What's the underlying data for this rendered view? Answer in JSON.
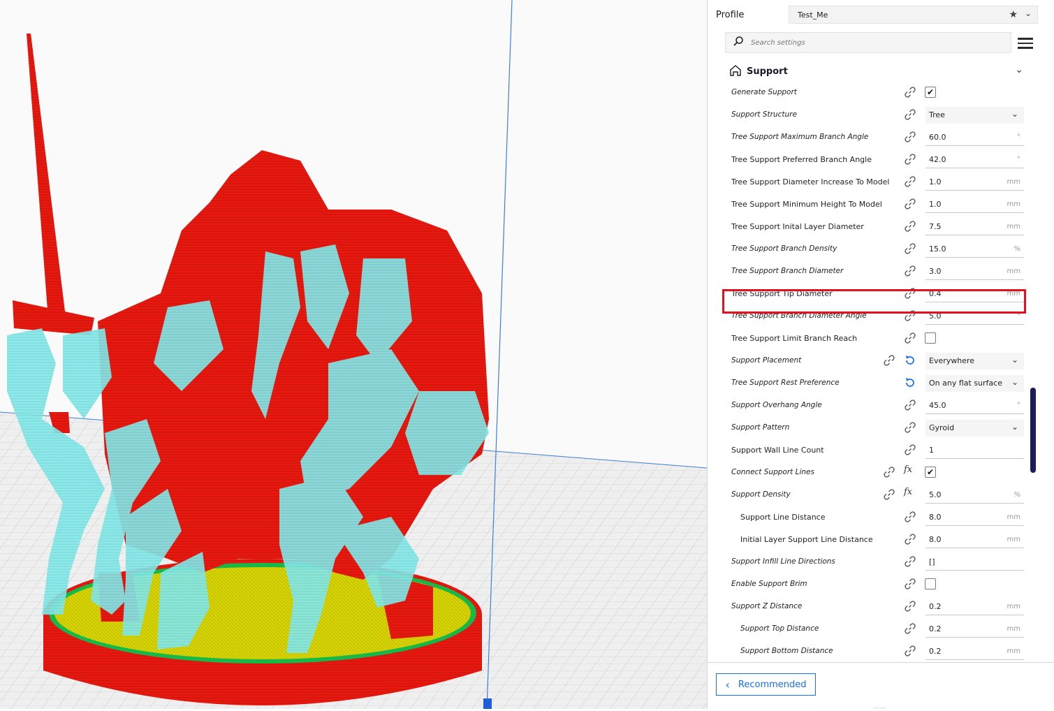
{
  "profile": {
    "label": "Profile",
    "value": "Test_Me"
  },
  "search": {
    "placeholder": "Search settings"
  },
  "category": {
    "label": "Support"
  },
  "settings": [
    {
      "label": "Generate Support",
      "type": "checkbox",
      "checked": true,
      "value": "✔"
    },
    {
      "label": "Support Structure",
      "type": "dropdown",
      "value": "Tree"
    },
    {
      "label": "Tree Support Maximum Branch Angle",
      "type": "number",
      "value": "60.0",
      "unit": "°"
    },
    {
      "label": "Tree Support Preferred Branch Angle",
      "type": "number",
      "value": "42.0",
      "unit": "°"
    },
    {
      "label": "Tree Support Diameter Increase To Model",
      "type": "number",
      "value": "1.0",
      "unit": "mm"
    },
    {
      "label": "Tree Support Minimum Height To Model",
      "type": "number",
      "value": "1.0",
      "unit": "mm"
    },
    {
      "label": "Tree Support Inital Layer Diameter",
      "type": "number",
      "value": "7.5",
      "unit": "mm"
    },
    {
      "label": "Tree Support Branch Density",
      "type": "number",
      "value": "15.0",
      "unit": "%"
    },
    {
      "label": "Tree Support Branch Diameter",
      "type": "number",
      "value": "3.0",
      "unit": "mm"
    },
    {
      "label": "Tree Support Tip Diameter",
      "type": "number",
      "value": "0.4",
      "unit": "mm"
    },
    {
      "label": "Tree Support Branch Diameter Angle",
      "type": "number",
      "value": "5.0",
      "unit": "°"
    },
    {
      "label": "Tree Support Limit Branch Reach",
      "type": "checkbox",
      "checked": false,
      "value": ""
    },
    {
      "label": "Support Placement",
      "type": "dropdown",
      "value": "Everywhere"
    },
    {
      "label": "Tree Support Rest Preference",
      "type": "dropdown",
      "value": "On any flat surface"
    },
    {
      "label": "Support Overhang Angle",
      "type": "number",
      "value": "45.0",
      "unit": "°"
    },
    {
      "label": "Support Pattern",
      "type": "dropdown",
      "value": "Gyroid"
    },
    {
      "label": "Support Wall Line Count",
      "type": "number",
      "value": "1",
      "unit": ""
    },
    {
      "label": "Connect Support Lines",
      "type": "checkbox",
      "checked": true,
      "value": "✔"
    },
    {
      "label": "Support Density",
      "type": "number",
      "value": "5.0",
      "unit": "%"
    },
    {
      "label": "Support Line Distance",
      "type": "number",
      "value": "8.0",
      "unit": "mm"
    },
    {
      "label": "Initial Layer Support Line Distance",
      "type": "number",
      "value": "8.0",
      "unit": "mm"
    },
    {
      "label": "Support Infill Line Directions",
      "type": "number",
      "value": "[]",
      "unit": ""
    },
    {
      "label": "Enable Support Brim",
      "type": "checkbox",
      "checked": false,
      "value": ""
    },
    {
      "label": "Support Z Distance",
      "type": "number",
      "value": "0.2",
      "unit": "mm"
    },
    {
      "label": "Support Top Distance",
      "type": "number",
      "value": "0.2",
      "unit": "mm"
    },
    {
      "label": "Support Bottom Distance",
      "type": "number",
      "value": "0.2",
      "unit": "mm"
    }
  ],
  "footer": {
    "recommended_label": "Recommended"
  },
  "colors": {
    "model": "#e8190f",
    "support": "#7fe6e6",
    "raft": "#d9d600",
    "accent": "#196ef0",
    "highlight": "#e3101e"
  },
  "icons": [
    "search-icon",
    "menu-icon",
    "support-category-icon",
    "chevron-down-icon",
    "link-icon",
    "reset-icon",
    "fx-icon",
    "star-icon",
    "chevron-left-icon"
  ]
}
